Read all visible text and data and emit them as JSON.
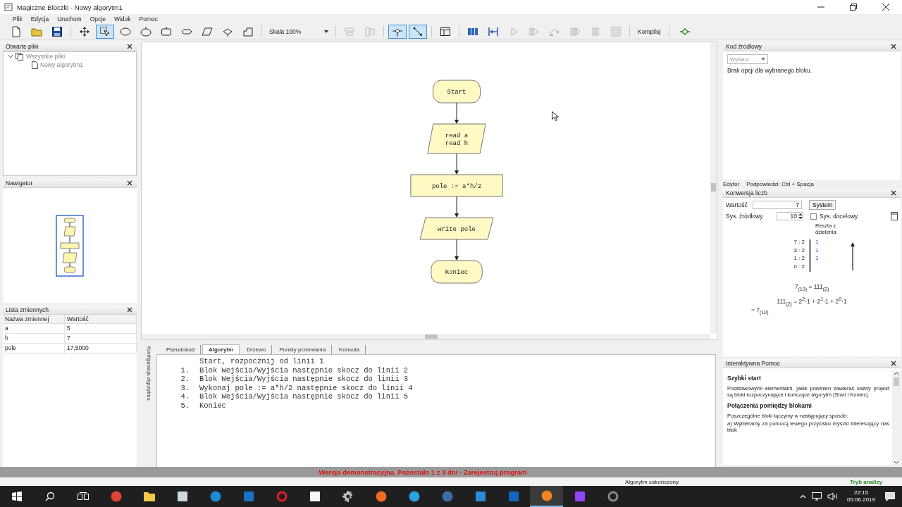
{
  "window": {
    "title": "Magiczne Bloczki - Nowy algorytm1"
  },
  "menu": [
    "Plik",
    "Edycja",
    "Uruchom",
    "Opcje",
    "Widok",
    "Pomoc"
  ],
  "toolbar": [
    {
      "kind": "new-file",
      "selected": false,
      "disabled": false
    },
    {
      "kind": "open-folder",
      "selected": false,
      "disabled": false
    },
    {
      "kind": "save",
      "selected": false,
      "disabled": false
    },
    {
      "kind": "separator"
    },
    {
      "kind": "move",
      "selected": false,
      "disabled": false
    },
    {
      "kind": "select",
      "selected": true,
      "disabled": false
    },
    {
      "kind": "ellipse",
      "selected": false,
      "disabled": false
    },
    {
      "kind": "oval",
      "selected": false,
      "disabled": false
    },
    {
      "kind": "rounded-rect",
      "selected": false,
      "disabled": false
    },
    {
      "kind": "hexagon",
      "selected": false,
      "disabled": false
    },
    {
      "kind": "parallelogram",
      "selected": false,
      "disabled": false
    },
    {
      "kind": "diamond",
      "selected": false,
      "disabled": false
    },
    {
      "kind": "tab-shape",
      "selected": false,
      "disabled": false
    },
    {
      "kind": "separator"
    },
    {
      "kind": "scale-select",
      "value": "Skala 100%"
    },
    {
      "kind": "separator"
    },
    {
      "kind": "align-h",
      "selected": false,
      "disabled": true
    },
    {
      "kind": "align-v",
      "selected": false,
      "disabled": true
    },
    {
      "kind": "separator"
    },
    {
      "kind": "connector",
      "selected": true,
      "disabled": false
    },
    {
      "kind": "connector-diagonal",
      "selected": true,
      "disabled": false
    },
    {
      "kind": "separator"
    },
    {
      "kind": "properties",
      "selected": false,
      "disabled": false
    },
    {
      "kind": "separator"
    },
    {
      "kind": "grid",
      "selected": false,
      "disabled": false
    },
    {
      "kind": "step-back",
      "selected": false,
      "disabled": false
    },
    {
      "kind": "play",
      "selected": false,
      "disabled": true
    },
    {
      "kind": "step-into",
      "selected": false,
      "disabled": true
    },
    {
      "kind": "step-over",
      "selected": false,
      "disabled": true
    },
    {
      "kind": "run-to",
      "selected": false,
      "disabled": true
    },
    {
      "kind": "pause",
      "selected": false,
      "disabled": true
    },
    {
      "kind": "stop",
      "selected": false,
      "disabled": true
    },
    {
      "kind": "separator"
    },
    {
      "kind": "text-button",
      "label": "Kompiluj"
    },
    {
      "kind": "separator"
    },
    {
      "kind": "flow-run",
      "selected": false,
      "disabled": false
    }
  ],
  "open_files": {
    "title": "Otwarte pliki",
    "tree": [
      {
        "label": "Wszystkie pliki",
        "expanded": true,
        "children": [
          {
            "label": "Nowy algorytm1"
          }
        ]
      }
    ]
  },
  "navigator": {
    "title": "Nawigator"
  },
  "variables": {
    "title": "Lista zmiennych",
    "columns": [
      "Nazwa zmiennej",
      "Wartość"
    ],
    "rows": [
      [
        "a",
        "5"
      ],
      [
        "h",
        "7"
      ],
      [
        "pole",
        "17,5000"
      ]
    ]
  },
  "flowchart": {
    "nodes": [
      {
        "kind": "terminal",
        "lines": [
          "Start"
        ]
      },
      {
        "kind": "io",
        "lines": [
          "read a",
          "read h"
        ]
      },
      {
        "kind": "process",
        "lines": [
          "pole := a*h/2"
        ]
      },
      {
        "kind": "io",
        "lines": [
          "write pole"
        ]
      },
      {
        "kind": "terminal",
        "lines": [
          "Koniec"
        ]
      }
    ]
  },
  "bottom_panel": {
    "side_tab": "Konfiguracja algorytmu",
    "tabs": [
      {
        "label": "Pseudokod",
        "selected": false
      },
      {
        "label": "Algorytm",
        "selected": true
      },
      {
        "label": "Drzewo",
        "selected": false
      },
      {
        "label": "Punkty przerwania",
        "selected": false
      },
      {
        "label": "Konsola",
        "selected": false
      }
    ],
    "header": "Start, rozpocznij od linii 1",
    "steps": [
      {
        "number": "1.",
        "text": "Blok Wejścia/Wyjścia następnie skocz do linii 2"
      },
      {
        "number": "2.",
        "text": "Blok Wejścia/Wyjścia następnie skocz do linii 3"
      },
      {
        "number": "3.",
        "text": "Wykonaj pole := a*h/2 następnie skocz do linii 4"
      },
      {
        "number": "4.",
        "text": "Blok Wejścia/Wyjścia następnie skocz do linii 5"
      },
      {
        "number": "5.",
        "text": "Koniec"
      }
    ]
  },
  "source_code": {
    "title": "Kod źródłowy",
    "language": {
      "value": "Wybierz",
      "disabled": true
    },
    "message": "Brak opcji dla wybranego bloku."
  },
  "editor_bar": {
    "label": "Edytor",
    "hint": "Podpowiedzi: Ctrl + Spacja"
  },
  "conversion": {
    "title": "Konwersja liczb",
    "value_label": "Wartość",
    "value": "7",
    "system_button": "System",
    "source_label": "Sys. źródłowy",
    "source_base": "10",
    "target_checkbox": {
      "label": "Sys. docelowy",
      "checked": false
    },
    "remainder_header": "Reszta z dzielenia",
    "divisions": [
      {
        "expr": "7 : 2",
        "remainder": "1"
      },
      {
        "expr": "3 : 2",
        "remainder": "1"
      },
      {
        "expr": "1 : 2",
        "remainder": "1"
      },
      {
        "expr": "0 : 2"
      }
    ],
    "formula": [
      "7$_{(10)}$ = 111$_{(2)}$",
      "111$_{(2)}$ = 2$^{2}$·1 + 2$^{1}$·1 + 2$^{0}$·1",
      "= 7$_{(10)}$"
    ]
  },
  "help": {
    "title": "Interaktywna Pomoc",
    "sections": [
      {
        "heading": "Szybki start",
        "paragraphs": [
          "Podstawowymi elementami, jakie powinien zawierać każdy projekt są bloki rozpoczynające i kończące algorytm (Start i Koniec)."
        ]
      },
      {
        "heading": "Połączenia pomiędzy blokami",
        "paragraphs": [
          "Poszczególne bloki łączymy w następujący sposób:",
          "a) Wybieramy za pomocą lewego przycisku myszki interesujący nas blok"
        ]
      }
    ]
  },
  "demo_banner": "Wersja demonstracyjna. Pozostało 1 z 3 dni - Zarejestruj program",
  "status_bar": {
    "message": "Algorytm zakończony.",
    "mode": "Tryb analizy"
  },
  "taskbar": {
    "apps": [
      {
        "kind": "circle",
        "color": "#db4437",
        "selected": false
      },
      {
        "kind": "folder",
        "color": "#f2c94c",
        "selected": false
      },
      {
        "kind": "square",
        "color": "#cfd8dc",
        "selected": false
      },
      {
        "kind": "circle",
        "color": "#1f8ad8",
        "selected": false
      },
      {
        "kind": "square",
        "color": "#1a73c8",
        "selected": false
      },
      {
        "kind": "ring",
        "color": "#e3202c",
        "selected": false
      },
      {
        "kind": "square",
        "color": "#f5f5f5",
        "selected": false
      },
      {
        "kind": "gear",
        "color": "#c0c0c0",
        "selected": false
      },
      {
        "kind": "circle",
        "color": "#f06a24",
        "selected": false
      },
      {
        "kind": "circle",
        "color": "#2aa1e0",
        "selected": false
      },
      {
        "kind": "circle",
        "color": "#3b6ea5",
        "selected": false
      },
      {
        "kind": "square",
        "color": "#2a8ad6",
        "selected": false
      },
      {
        "kind": "square",
        "color": "#1565c0",
        "selected": false
      },
      {
        "kind": "circle",
        "color": "#f58220",
        "selected": true
      },
      {
        "kind": "square",
        "color": "#9146ff",
        "selected": false
      },
      {
        "kind": "ring",
        "color": "#8a8a8a",
        "selected": false
      }
    ],
    "time": "22:15",
    "date": "05.06.2019"
  }
}
